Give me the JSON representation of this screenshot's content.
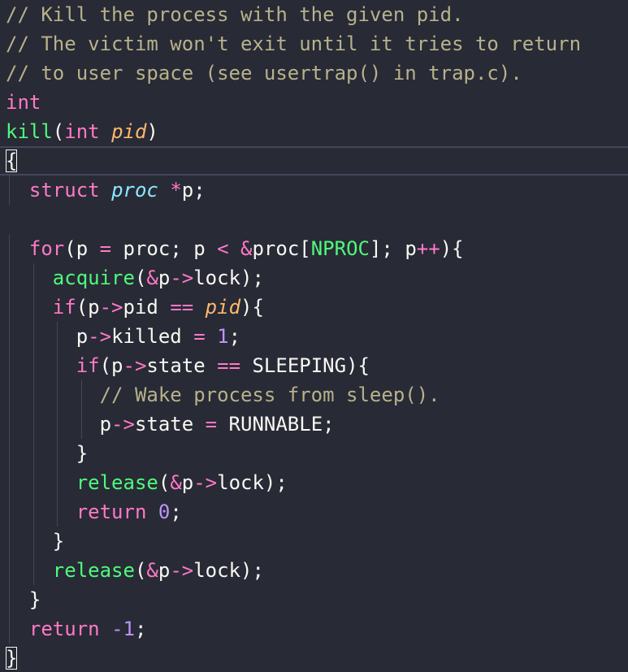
{
  "editor": {
    "background": "#282a36",
    "colors": {
      "comment": "#b7b28a",
      "keyword": "#ff79c6",
      "function": "#50fa7b",
      "parameter": "#ffb86c",
      "type": "#8be9fd",
      "number": "#bd93f9",
      "text": "#f8f8f2"
    },
    "lines": [
      {
        "tokens": [
          {
            "t": "// Kill the process with the given pid.",
            "c": "comment"
          }
        ]
      },
      {
        "tokens": [
          {
            "t": "// The victim won't exit until it tries to return",
            "c": "comment"
          }
        ]
      },
      {
        "tokens": [
          {
            "t": "// to user space (see usertrap() in trap.c).",
            "c": "comment"
          }
        ]
      },
      {
        "tokens": [
          {
            "t": "int",
            "c": "keyword"
          }
        ]
      },
      {
        "tokens": [
          {
            "t": "kill",
            "c": "func"
          },
          {
            "t": "(",
            "c": "text"
          },
          {
            "t": "int",
            "c": "keyword"
          },
          {
            "t": " ",
            "c": "text"
          },
          {
            "t": "pid",
            "c": "param"
          },
          {
            "t": ")",
            "c": "text"
          }
        ]
      },
      {
        "current": true,
        "tokens": [
          {
            "t": "{",
            "c": "text",
            "cursor": true
          }
        ]
      },
      {
        "tokens": [
          {
            "t": "  ",
            "c": "text"
          },
          {
            "t": "struct",
            "c": "keyword"
          },
          {
            "t": " ",
            "c": "text"
          },
          {
            "t": "proc",
            "c": "type"
          },
          {
            "t": " ",
            "c": "text"
          },
          {
            "t": "*",
            "c": "op"
          },
          {
            "t": "p;",
            "c": "text"
          }
        ]
      },
      {
        "tokens": [
          {
            "t": "",
            "c": "text"
          }
        ]
      },
      {
        "tokens": [
          {
            "t": "  ",
            "c": "text"
          },
          {
            "t": "for",
            "c": "keyword"
          },
          {
            "t": "(p ",
            "c": "text"
          },
          {
            "t": "=",
            "c": "op"
          },
          {
            "t": " proc; p ",
            "c": "text"
          },
          {
            "t": "<",
            "c": "op"
          },
          {
            "t": " ",
            "c": "text"
          },
          {
            "t": "&",
            "c": "op"
          },
          {
            "t": "proc[",
            "c": "text"
          },
          {
            "t": "NPROC",
            "c": "const"
          },
          {
            "t": "]; p",
            "c": "text"
          },
          {
            "t": "++",
            "c": "op"
          },
          {
            "t": "){",
            "c": "text"
          }
        ]
      },
      {
        "tokens": [
          {
            "t": "    ",
            "c": "text"
          },
          {
            "t": "acquire",
            "c": "func"
          },
          {
            "t": "(",
            "c": "text"
          },
          {
            "t": "&",
            "c": "op"
          },
          {
            "t": "p",
            "c": "text"
          },
          {
            "t": "->",
            "c": "op"
          },
          {
            "t": "lock);",
            "c": "text"
          }
        ]
      },
      {
        "tokens": [
          {
            "t": "    ",
            "c": "text"
          },
          {
            "t": "if",
            "c": "keyword"
          },
          {
            "t": "(p",
            "c": "text"
          },
          {
            "t": "->",
            "c": "op"
          },
          {
            "t": "pid ",
            "c": "text"
          },
          {
            "t": "==",
            "c": "op"
          },
          {
            "t": " ",
            "c": "text"
          },
          {
            "t": "pid",
            "c": "param"
          },
          {
            "t": "){",
            "c": "text"
          }
        ]
      },
      {
        "tokens": [
          {
            "t": "      p",
            "c": "text"
          },
          {
            "t": "->",
            "c": "op"
          },
          {
            "t": "killed ",
            "c": "text"
          },
          {
            "t": "=",
            "c": "op"
          },
          {
            "t": " ",
            "c": "text"
          },
          {
            "t": "1",
            "c": "number"
          },
          {
            "t": ";",
            "c": "text"
          }
        ]
      },
      {
        "tokens": [
          {
            "t": "      ",
            "c": "text"
          },
          {
            "t": "if",
            "c": "keyword"
          },
          {
            "t": "(p",
            "c": "text"
          },
          {
            "t": "->",
            "c": "op"
          },
          {
            "t": "state ",
            "c": "text"
          },
          {
            "t": "==",
            "c": "op"
          },
          {
            "t": " SLEEPING){",
            "c": "text"
          }
        ]
      },
      {
        "tokens": [
          {
            "t": "        ",
            "c": "text"
          },
          {
            "t": "// Wake process from sleep().",
            "c": "comment"
          }
        ]
      },
      {
        "tokens": [
          {
            "t": "        p",
            "c": "text"
          },
          {
            "t": "->",
            "c": "op"
          },
          {
            "t": "state ",
            "c": "text"
          },
          {
            "t": "=",
            "c": "op"
          },
          {
            "t": " RUNNABLE;",
            "c": "text"
          }
        ]
      },
      {
        "tokens": [
          {
            "t": "      }",
            "c": "text"
          }
        ]
      },
      {
        "tokens": [
          {
            "t": "      ",
            "c": "text"
          },
          {
            "t": "release",
            "c": "func"
          },
          {
            "t": "(",
            "c": "text"
          },
          {
            "t": "&",
            "c": "op"
          },
          {
            "t": "p",
            "c": "text"
          },
          {
            "t": "->",
            "c": "op"
          },
          {
            "t": "lock);",
            "c": "text"
          }
        ]
      },
      {
        "tokens": [
          {
            "t": "      ",
            "c": "text"
          },
          {
            "t": "return",
            "c": "keyword"
          },
          {
            "t": " ",
            "c": "text"
          },
          {
            "t": "0",
            "c": "number"
          },
          {
            "t": ";",
            "c": "text"
          }
        ]
      },
      {
        "tokens": [
          {
            "t": "    }",
            "c": "text"
          }
        ]
      },
      {
        "tokens": [
          {
            "t": "    ",
            "c": "text"
          },
          {
            "t": "release",
            "c": "func"
          },
          {
            "t": "(",
            "c": "text"
          },
          {
            "t": "&",
            "c": "op"
          },
          {
            "t": "p",
            "c": "text"
          },
          {
            "t": "->",
            "c": "op"
          },
          {
            "t": "lock);",
            "c": "text"
          }
        ]
      },
      {
        "tokens": [
          {
            "t": "  }",
            "c": "text"
          }
        ]
      },
      {
        "tokens": [
          {
            "t": "  ",
            "c": "text"
          },
          {
            "t": "return",
            "c": "keyword"
          },
          {
            "t": " ",
            "c": "text"
          },
          {
            "t": "-1",
            "c": "number"
          },
          {
            "t": ";",
            "c": "text"
          }
        ]
      },
      {
        "tokens": [
          {
            "t": "}",
            "c": "text",
            "cursor": true
          }
        ]
      }
    ]
  }
}
